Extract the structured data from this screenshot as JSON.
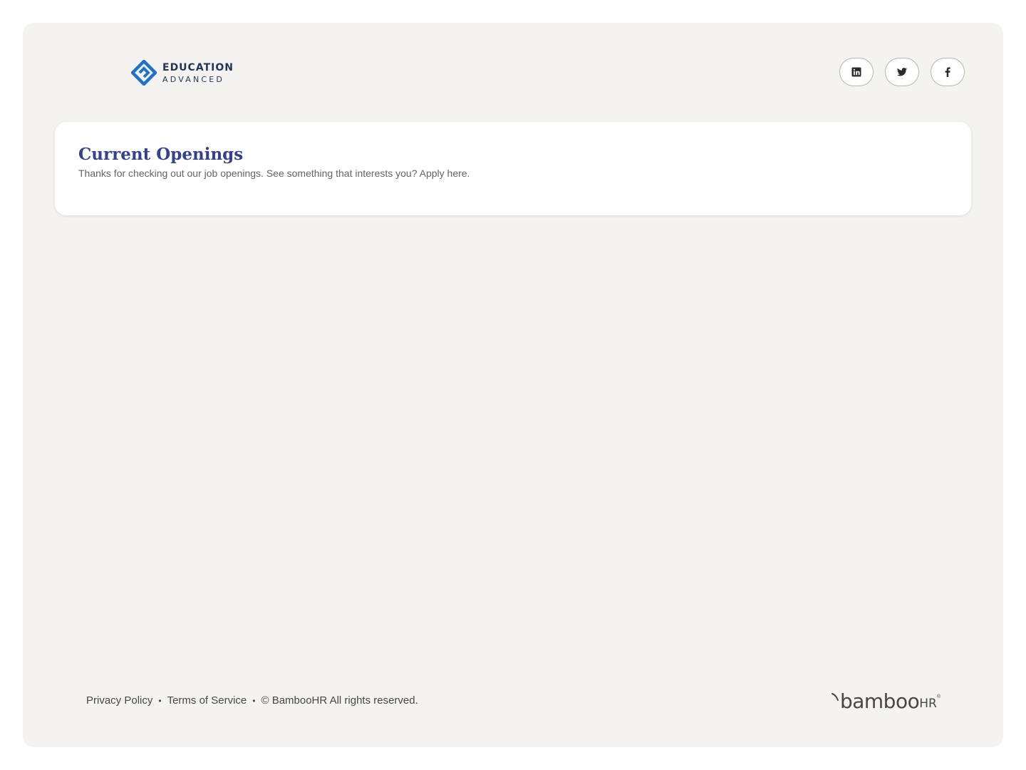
{
  "header": {
    "logo": {
      "line1": "EDUCATION",
      "line2": "ADVANCED",
      "brand_color": "#1e73c8"
    },
    "socials": [
      {
        "name": "linkedin",
        "icon": "linkedin-icon"
      },
      {
        "name": "twitter",
        "icon": "twitter-icon"
      },
      {
        "name": "facebook",
        "icon": "facebook-icon"
      }
    ]
  },
  "openings": {
    "title": "Current Openings",
    "subtitle": "Thanks for checking out our job openings. See something that interests you? Apply here.",
    "title_color": "#34418e"
  },
  "footer": {
    "privacy": "Privacy Policy",
    "separator": "•",
    "terms": "Terms of Service",
    "copyright": "© BambooHR All rights reserved.",
    "brand_word": "bamboo",
    "brand_suffix": "HR",
    "brand_tm": "®"
  }
}
